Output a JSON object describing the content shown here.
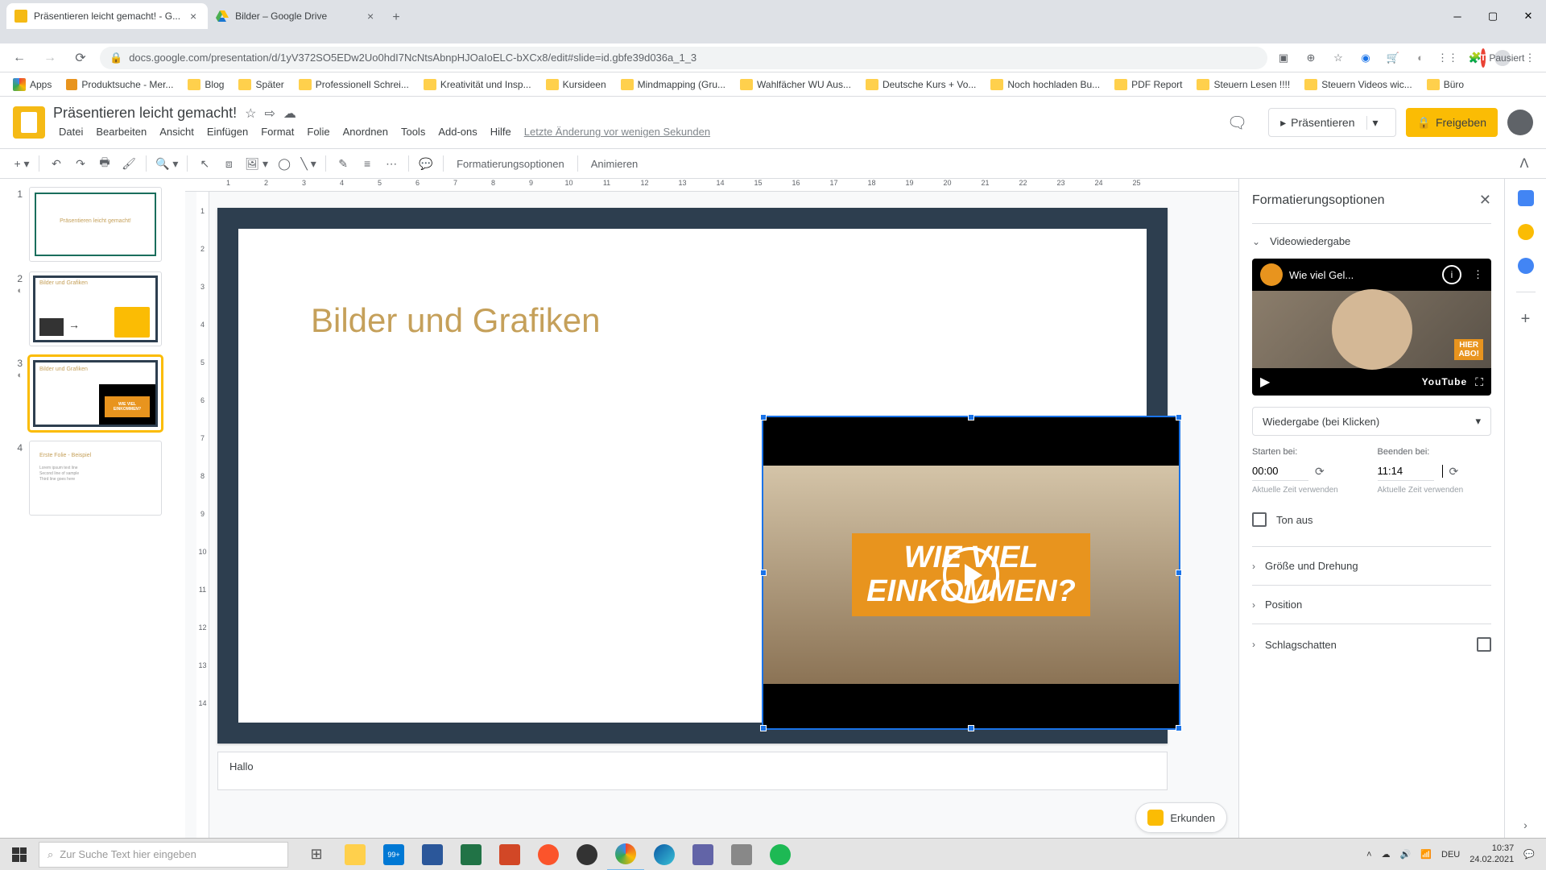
{
  "browser": {
    "tabs": [
      {
        "title": "Präsentieren leicht gemacht! - G..."
      },
      {
        "title": "Bilder – Google Drive"
      }
    ],
    "url": "docs.google.com/presentation/d/1yV372SO5EDw2Uo0hdI7NcNtsAbnpHJOaIoELC-bXCx8/edit#slide=id.gbfe39d036a_1_3",
    "pause_label": "Pausiert",
    "avatar_initial": "T"
  },
  "bookmarks": [
    "Apps",
    "Produktsuche - Mer...",
    "Blog",
    "Später",
    "Professionell Schrei...",
    "Kreativität und Insp...",
    "Kursideen",
    "Mindmapping  (Gru...",
    "Wahlfächer WU Aus...",
    "Deutsche Kurs + Vo...",
    "Noch hochladen Bu...",
    "PDF Report",
    "Steuern Lesen !!!!",
    "Steuern Videos wic...",
    "Büro"
  ],
  "doc": {
    "title": "Präsentieren leicht gemacht!",
    "menus": [
      "Datei",
      "Bearbeiten",
      "Ansicht",
      "Einfügen",
      "Format",
      "Folie",
      "Anordnen",
      "Tools",
      "Add-ons",
      "Hilfe"
    ],
    "last_edit": "Letzte Änderung vor wenigen Sekunden",
    "present": "Präsentieren",
    "share": "Freigeben"
  },
  "toolbar": {
    "format_options": "Formatierungsoptionen",
    "animate": "Animieren"
  },
  "slide": {
    "title": "Bilder und Grafiken",
    "video_overlay_1": "WIE VIEL",
    "video_overlay_2": "EINKOMMEN?",
    "notes": "Hallo",
    "explore": "Erkunden"
  },
  "thumbs": {
    "t1": "Präsentieren leicht gemacht!",
    "t2": "Bilder und Grafiken",
    "t3": "Bilder und Grafiken",
    "t4": "Erste Folie - Beispiel"
  },
  "sidebar": {
    "title": "Formatierungsoptionen",
    "section_video": "Videowiedergabe",
    "video_title": "Wie viel Gel...",
    "badge1": "HIER",
    "badge2": "ABO!",
    "youtube": "YouTube",
    "playback_mode": "Wiedergabe (bei Klicken)",
    "start_label": "Starten bei:",
    "end_label": "Beenden bei:",
    "start_value": "00:00",
    "end_value": "11:14",
    "use_current": "Aktuelle Zeit verwenden",
    "mute": "Ton aus",
    "size_rotation": "Größe und Drehung",
    "position": "Position",
    "shadow": "Schlagschatten"
  },
  "taskbar": {
    "search_placeholder": "Zur Suche Text hier eingeben",
    "lang": "DEU",
    "time": "10:37",
    "date": "24.02.2021",
    "badge": "99+"
  },
  "ruler_h": [
    "",
    "1",
    "2",
    "3",
    "4",
    "5",
    "6",
    "7",
    "8",
    "9",
    "10",
    "11",
    "12",
    "13",
    "14",
    "15",
    "16",
    "17",
    "18",
    "19",
    "20",
    "21",
    "22",
    "23",
    "24",
    "25"
  ],
  "ruler_v": [
    "",
    "1",
    "2",
    "3",
    "4",
    "5",
    "6",
    "7",
    "8",
    "9",
    "10",
    "11",
    "12",
    "13",
    "14"
  ]
}
